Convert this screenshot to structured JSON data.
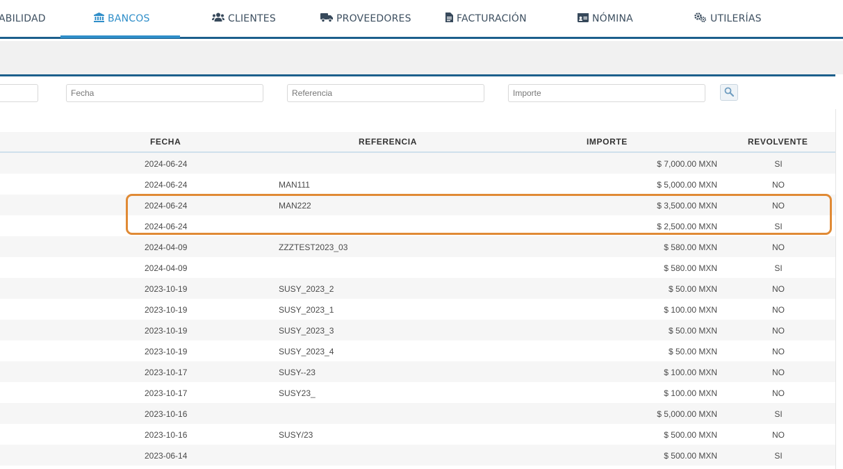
{
  "nav": {
    "items": [
      {
        "label": "ABILIDAD",
        "icon": "",
        "active": false
      },
      {
        "label": "BANCOS",
        "icon": "bank-icon",
        "active": true
      },
      {
        "label": "CLIENTES",
        "icon": "users-icon",
        "active": false
      },
      {
        "label": "PROVEEDORES",
        "icon": "truck-icon",
        "active": false
      },
      {
        "label": "FACTURACIÓN",
        "icon": "file-icon",
        "active": false
      },
      {
        "label": "NÓMINA",
        "icon": "id-card-icon",
        "active": false
      },
      {
        "label": "UTILERÍAS",
        "icon": "cogs-icon",
        "active": false
      }
    ]
  },
  "filters": {
    "fecha_placeholder": "Fecha",
    "referencia_placeholder": "Referencia",
    "importe_placeholder": "Importe",
    "search_icon": "search-icon"
  },
  "table": {
    "headers": {
      "fecha": "FECHA",
      "referencia": "REFERENCIA",
      "importe": "IMPORTE",
      "revolvente": "REVOLVENTE"
    },
    "rows": [
      {
        "fecha": "2024-06-24",
        "referencia": "",
        "importe": "$ 7,000.00 MXN",
        "revolvente": "SI"
      },
      {
        "fecha": "2024-06-24",
        "referencia": "MAN111",
        "importe": "$ 5,000.00 MXN",
        "revolvente": "NO"
      },
      {
        "fecha": "2024-06-24",
        "referencia": "MAN222",
        "importe": "$ 3,500.00 MXN",
        "revolvente": "NO"
      },
      {
        "fecha": "2024-06-24",
        "referencia": "",
        "importe": "$ 2,500.00 MXN",
        "revolvente": "SI"
      },
      {
        "fecha": "2024-04-09",
        "referencia": "ZZZTEST2023_03",
        "importe": "$ 580.00 MXN",
        "revolvente": "NO"
      },
      {
        "fecha": "2024-04-09",
        "referencia": "",
        "importe": "$ 580.00 MXN",
        "revolvente": "SI"
      },
      {
        "fecha": "2023-10-19",
        "referencia": "SUSY_2023_2",
        "importe": "$ 50.00 MXN",
        "revolvente": "NO"
      },
      {
        "fecha": "2023-10-19",
        "referencia": "SUSY_2023_1",
        "importe": "$ 100.00 MXN",
        "revolvente": "NO"
      },
      {
        "fecha": "2023-10-19",
        "referencia": "SUSY_2023_3",
        "importe": "$ 50.00 MXN",
        "revolvente": "NO"
      },
      {
        "fecha": "2023-10-19",
        "referencia": "SUSY_2023_4",
        "importe": "$ 50.00 MXN",
        "revolvente": "NO"
      },
      {
        "fecha": "2023-10-17",
        "referencia": "SUSY--23",
        "importe": "$ 100.00 MXN",
        "revolvente": "NO"
      },
      {
        "fecha": "2023-10-17",
        "referencia": "SUSY23_",
        "importe": "$ 100.00 MXN",
        "revolvente": "NO"
      },
      {
        "fecha": "2023-10-16",
        "referencia": "",
        "importe": "$ 5,000.00 MXN",
        "revolvente": "SI"
      },
      {
        "fecha": "2023-10-16",
        "referencia": "SUSY/23",
        "importe": "$ 500.00 MXN",
        "revolvente": "NO"
      },
      {
        "fecha": "2023-06-14",
        "referencia": "",
        "importe": "$ 500.00 MXN",
        "revolvente": "SI"
      }
    ]
  },
  "colors": {
    "accent": "#2f8ec9",
    "navy": "#1c5f8c",
    "highlight": "#e08a35"
  }
}
